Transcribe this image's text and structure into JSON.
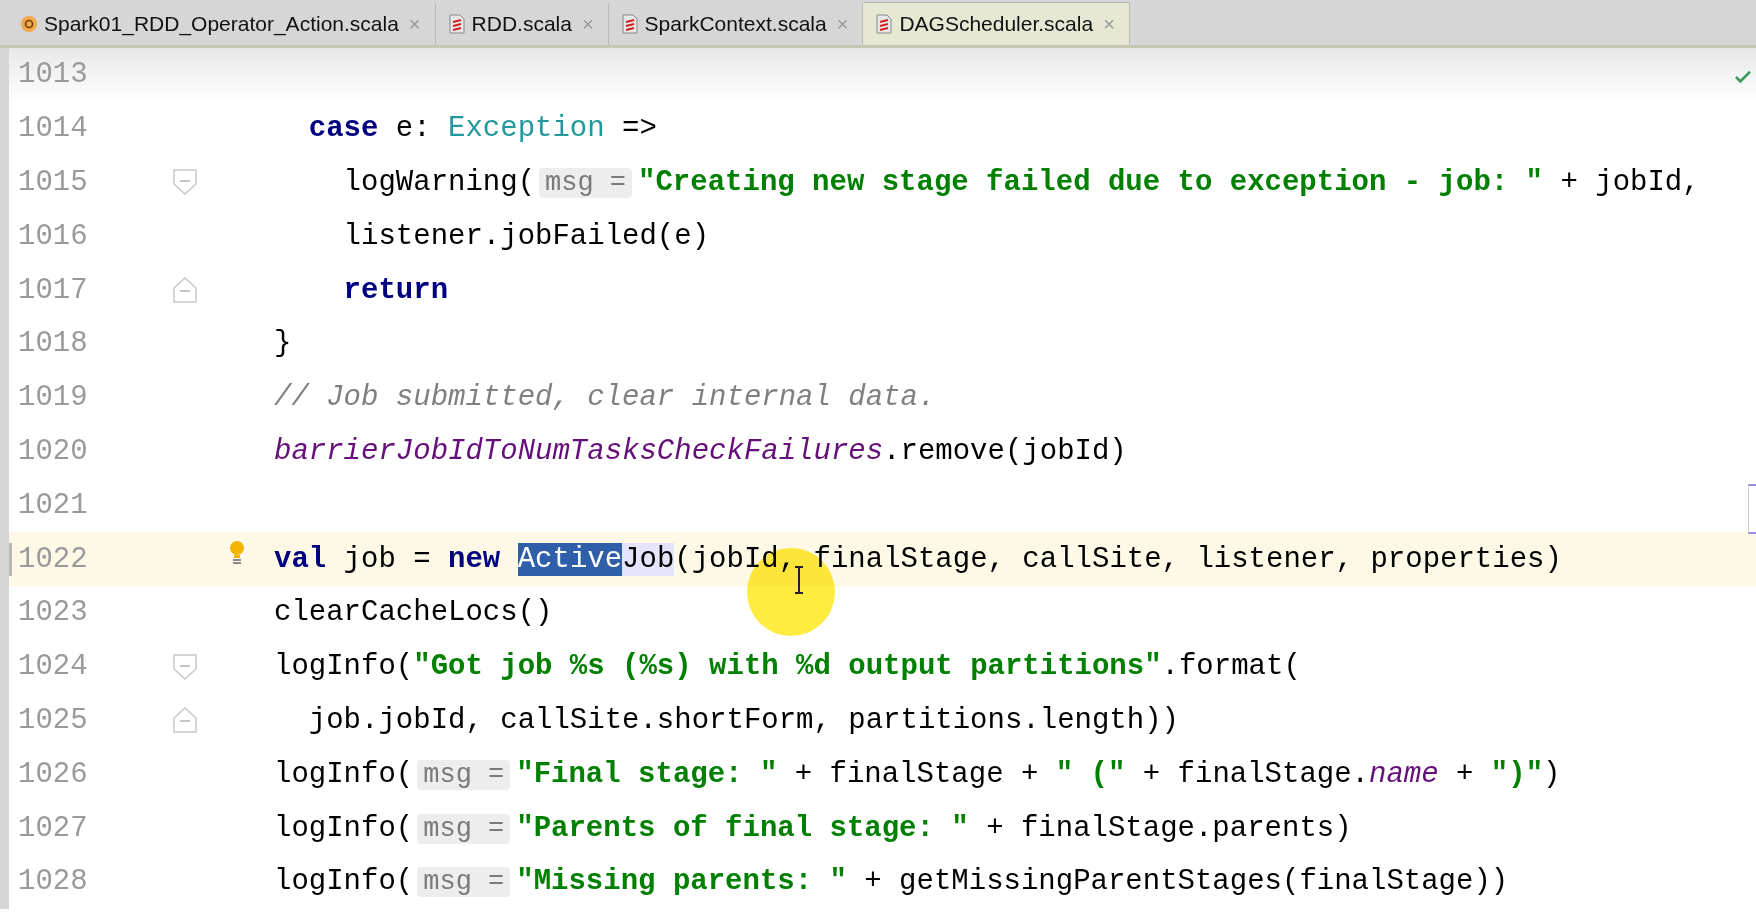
{
  "tabs": [
    {
      "label": "Spark01_RDD_Operator_Action.scala",
      "kind": "object",
      "close": "×",
      "selected": false
    },
    {
      "label": "RDD.scala",
      "kind": "file",
      "close": "×",
      "selected": false
    },
    {
      "label": "SparkContext.scala",
      "kind": "file",
      "close": "×",
      "selected": false
    },
    {
      "label": "DAGScheduler.scala",
      "kind": "file",
      "close": "×",
      "selected": true
    }
  ],
  "editor": {
    "lines": [
      {
        "number": "1013",
        "current": false
      },
      {
        "number": "1014",
        "current": false,
        "tokens": [
          {
            "kind": "keyword",
            "text": "  case"
          },
          {
            "kind": "plain",
            "text": " e: "
          },
          {
            "kind": "type",
            "text": "Exception"
          },
          {
            "kind": "plain",
            "text": " =>"
          }
        ]
      },
      {
        "number": "1015",
        "current": false,
        "fold_marker": {
          "kind": "start"
        },
        "tokens": [
          {
            "kind": "plain",
            "text": "    logWarning("
          },
          {
            "kind": "hint",
            "text": "msg ="
          },
          {
            "kind": "string",
            "text": "\"Creating new stage failed due to exception - job: \""
          },
          {
            "kind": "plain",
            "text": " + jobId,"
          }
        ]
      },
      {
        "number": "1016",
        "current": false,
        "tokens": [
          {
            "kind": "plain",
            "text": "    listener.jobFailed(e)"
          }
        ]
      },
      {
        "number": "1017",
        "current": false,
        "fold_marker": {
          "kind": "end"
        },
        "tokens": [
          {
            "kind": "keyword",
            "text": "    return"
          }
        ]
      },
      {
        "number": "1018",
        "current": false,
        "tokens": [
          {
            "kind": "plain",
            "text": "}"
          }
        ]
      },
      {
        "number": "1019",
        "current": false,
        "tokens": [
          {
            "kind": "comment",
            "text": "// Job submitted, clear internal data."
          }
        ]
      },
      {
        "number": "1020",
        "current": false,
        "tokens": [
          {
            "kind": "field",
            "text": "barrierJobIdToNumTasksCheckFailures"
          },
          {
            "kind": "plain",
            "text": ".remove(jobId)"
          }
        ]
      },
      {
        "number": "1021",
        "current": false
      },
      {
        "number": "1022",
        "current": true,
        "gutter_icon": {
          "kind": "bulb"
        },
        "tokens": [
          {
            "kind": "keyword",
            "text": "val"
          },
          {
            "kind": "plain",
            "text": " job = "
          },
          {
            "kind": "keyword",
            "text": "new "
          },
          {
            "kind": "selection",
            "text": "Active"
          },
          {
            "kind": "usage",
            "text": "Job"
          },
          {
            "kind": "plain",
            "text": "(jobId, finalStage, callSite, listener, properties)"
          }
        ]
      },
      {
        "number": "1023",
        "current": false,
        "tokens": [
          {
            "kind": "plain",
            "text": "clearCacheLocs()"
          }
        ]
      },
      {
        "number": "1024",
        "current": false,
        "fold_marker": {
          "kind": "start"
        },
        "tokens": [
          {
            "kind": "plain",
            "text": "logInfo("
          },
          {
            "kind": "string",
            "text": "\"Got job %s (%s) with %d output partitions\""
          },
          {
            "kind": "plain",
            "text": ".format("
          }
        ]
      },
      {
        "number": "1025",
        "current": false,
        "fold_marker": {
          "kind": "end"
        },
        "tokens": [
          {
            "kind": "plain",
            "text": "  job.jobId, callSite.shortForm, partitions.length))"
          }
        ]
      },
      {
        "number": "1026",
        "current": false,
        "tokens": [
          {
            "kind": "plain",
            "text": "logInfo("
          },
          {
            "kind": "hint",
            "text": "msg ="
          },
          {
            "kind": "string",
            "text": "\"Final stage: \""
          },
          {
            "kind": "plain",
            "text": " + finalStage + "
          },
          {
            "kind": "string",
            "text": "\" (\""
          },
          {
            "kind": "plain",
            "text": " + finalStage."
          },
          {
            "kind": "field",
            "text": "name"
          },
          {
            "kind": "plain",
            "text": " + "
          },
          {
            "kind": "string",
            "text": "\")\""
          },
          {
            "kind": "plain",
            "text": ")"
          }
        ]
      },
      {
        "number": "1027",
        "current": false,
        "tokens": [
          {
            "kind": "plain",
            "text": "logInfo("
          },
          {
            "kind": "hint",
            "text": "msg ="
          },
          {
            "kind": "string",
            "text": "\"Parents of final stage: \""
          },
          {
            "kind": "plain",
            "text": " + finalStage.parents)"
          }
        ]
      },
      {
        "number": "1028",
        "current": false,
        "tokens": [
          {
            "kind": "plain",
            "text": "logInfo("
          },
          {
            "kind": "hint",
            "text": "msg ="
          },
          {
            "kind": "string",
            "text": "\"Missing parents: \""
          },
          {
            "kind": "plain",
            "text": " + getMissingParentStages(finalStage))"
          }
        ]
      }
    ]
  }
}
